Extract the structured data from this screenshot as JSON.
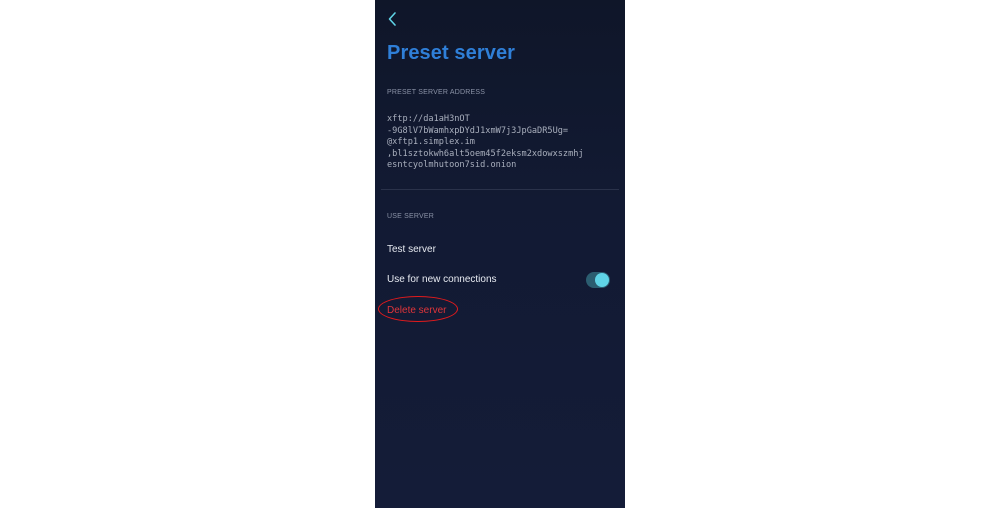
{
  "page": {
    "title": "Preset server"
  },
  "address_section": {
    "header": "PRESET SERVER ADDRESS",
    "address": "xftp://da1aH3nOT\n-9G8lV7bWamhxpDYdJ1xmW7j3JpGaDR5Ug=\n@xftp1.simplex.im\n,bl1sztokwh6alt5oem45f2eksm2xdowxszmhj\nesntcyolmhutoon7sid.onion"
  },
  "use_section": {
    "header": "USE SERVER",
    "test_server": "Test server",
    "use_for_new_connections": "Use for new connections",
    "use_for_new_connections_enabled": true,
    "delete_server": "Delete server"
  },
  "colors": {
    "title": "#2f7fd8",
    "accent": "#5fd3e6",
    "danger": "#e0353a",
    "annotation": "#e31a1c"
  },
  "icons": {
    "back": "chevron-left-icon"
  }
}
